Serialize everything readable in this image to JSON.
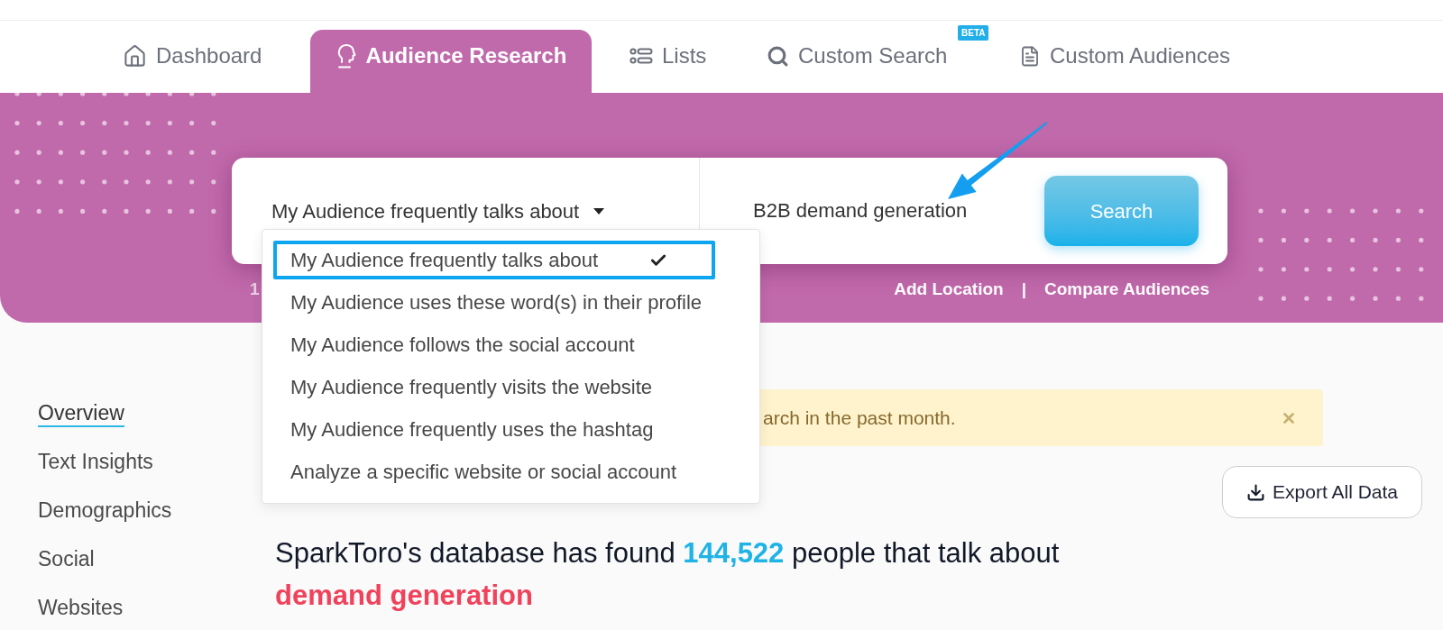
{
  "nav": {
    "tabs": [
      {
        "label": "Dashboard",
        "selected": false
      },
      {
        "label": "Audience Research",
        "selected": true
      },
      {
        "label": "Lists",
        "selected": false
      },
      {
        "label": "Custom Search",
        "selected": false,
        "badge": "BETA"
      },
      {
        "label": "Custom Audiences",
        "selected": false
      }
    ]
  },
  "search": {
    "mode": {
      "value": "My Audience frequently talks about",
      "expanded": true
    },
    "options": [
      {
        "label": "My Audience frequently talks about",
        "selected": true
      },
      {
        "label": "My Audience uses these word(s) in their profile",
        "selected": false
      },
      {
        "label": "My Audience follows the social account",
        "selected": false
      },
      {
        "label": "My Audience frequently visits the website",
        "selected": false
      },
      {
        "label": "My Audience frequently uses the hashtag",
        "selected": false
      },
      {
        "label": "Analyze a specific website or social account",
        "selected": false
      }
    ],
    "query": {
      "value": "B2B demand generation"
    },
    "button": "Search"
  },
  "search_footer": {
    "note": "1",
    "links": [
      "Add Location",
      "Compare Audiences"
    ],
    "separator": "|"
  },
  "sidebar": {
    "items": [
      {
        "label": "Overview",
        "selected": true
      },
      {
        "label": "Text Insights",
        "selected": false
      },
      {
        "label": "Demographics",
        "selected": false
      },
      {
        "label": "Social",
        "selected": false
      },
      {
        "label": "Websites",
        "selected": false
      }
    ]
  },
  "alert": {
    "text": "arch in the past month."
  },
  "export_button": "Export All Data",
  "overview": {
    "summary": {
      "before": "SparkToro's database has found",
      "count": "144,522",
      "after": "people that talk about",
      "topic": "demand generation"
    }
  }
}
